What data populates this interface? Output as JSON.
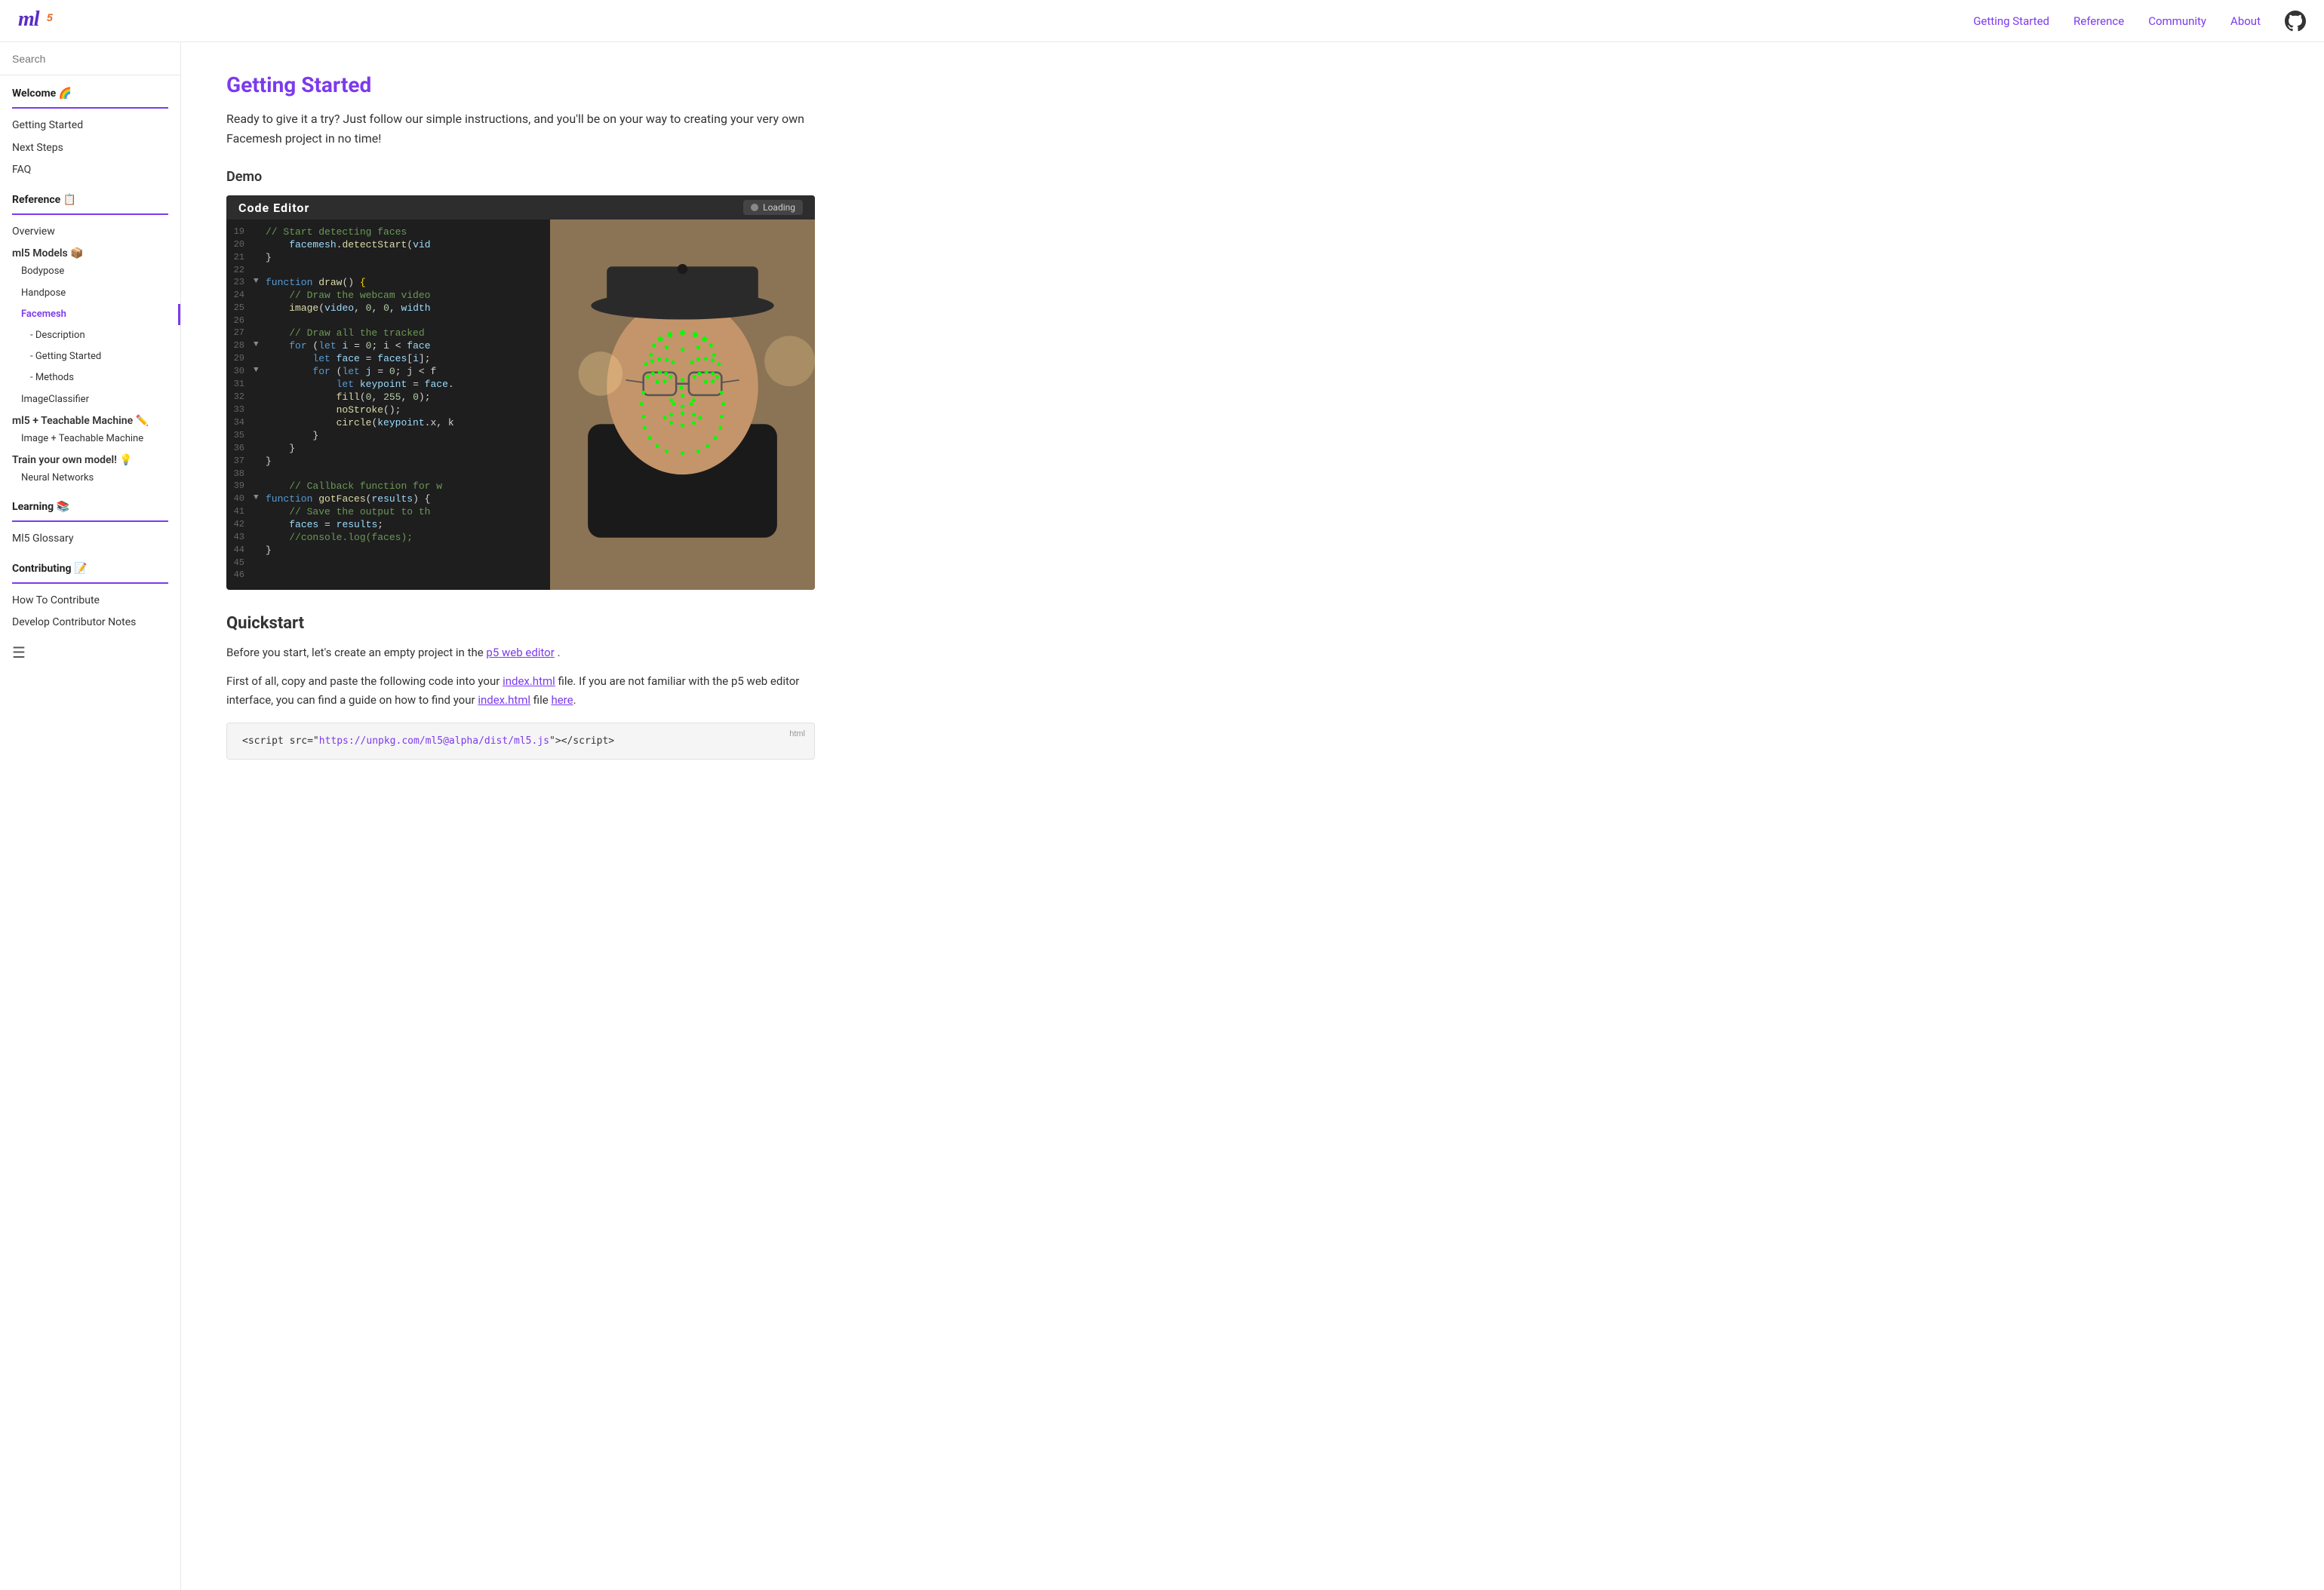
{
  "nav": {
    "logo_text": "ml",
    "logo_sub": "5",
    "links": [
      {
        "label": "Getting Started",
        "id": "getting-started"
      },
      {
        "label": "Reference",
        "id": "reference"
      },
      {
        "label": "Community",
        "id": "community"
      },
      {
        "label": "About",
        "id": "about"
      }
    ]
  },
  "sidebar": {
    "search_placeholder": "Search",
    "sections": [
      {
        "title": "Welcome 🌈",
        "items": [
          {
            "label": "Getting Started",
            "indent": 0,
            "active": false
          },
          {
            "label": "Next Steps",
            "indent": 0,
            "active": false
          },
          {
            "label": "FAQ",
            "indent": 0,
            "active": false
          }
        ]
      },
      {
        "title": "Reference 📋",
        "items": [
          {
            "label": "Overview",
            "indent": 0,
            "active": false
          },
          {
            "label": "ml5 Models 📦",
            "indent": 0,
            "group": true
          },
          {
            "label": "Bodypose",
            "indent": 1,
            "active": false
          },
          {
            "label": "Handpose",
            "indent": 1,
            "active": false
          },
          {
            "label": "Facemesh",
            "indent": 1,
            "active": true
          },
          {
            "label": "- Description",
            "indent": 2,
            "active": false
          },
          {
            "label": "- Getting Started",
            "indent": 2,
            "active": false
          },
          {
            "label": "- Methods",
            "indent": 2,
            "active": false
          },
          {
            "label": "ImageClassifier",
            "indent": 1,
            "active": false
          },
          {
            "label": "ml5 + Teachable Machine ✏️",
            "indent": 0,
            "group": true
          },
          {
            "label": "Image + Teachable Machine",
            "indent": 1,
            "active": false
          },
          {
            "label": "Train your own model! 💡",
            "indent": 0,
            "group": true
          },
          {
            "label": "Neural Networks",
            "indent": 1,
            "active": false
          }
        ]
      },
      {
        "title": "Learning 📚",
        "items": [
          {
            "label": "Ml5 Glossary",
            "indent": 0,
            "active": false
          }
        ]
      },
      {
        "title": "Contributing 📝",
        "items": [
          {
            "label": "How To Contribute",
            "indent": 0,
            "active": false
          },
          {
            "label": "Develop Contributor Notes",
            "indent": 0,
            "active": false
          }
        ]
      }
    ]
  },
  "main": {
    "page_title": "Getting Started",
    "intro": "Ready to give it a try? Just follow our simple instructions, and you'll be on your way to creating your very own Facemesh project in no time!",
    "demo_label": "Demo",
    "code_editor_title": "Code Editor",
    "loading_label": "Loading",
    "code_lines": [
      {
        "num": "19",
        "arrow": "",
        "text": "// Start detecting faces"
      },
      {
        "num": "20",
        "arrow": "",
        "text": "    facemesh.detectStart(vi"
      },
      {
        "num": "21",
        "arrow": "",
        "text": "}"
      },
      {
        "num": "22",
        "arrow": "",
        "text": ""
      },
      {
        "num": "23",
        "arrow": "▼",
        "text": "function draw() {"
      },
      {
        "num": "24",
        "arrow": "",
        "text": "    // Draw the webcam video"
      },
      {
        "num": "25",
        "arrow": "",
        "text": "    image(video, 0, 0, width"
      },
      {
        "num": "26",
        "arrow": "",
        "text": ""
      },
      {
        "num": "27",
        "arrow": "",
        "text": "    // Draw all the tracked"
      },
      {
        "num": "28",
        "arrow": "▼",
        "text": "    for (let i = 0; i < face"
      },
      {
        "num": "29",
        "arrow": "",
        "text": "        let face = faces[i];"
      },
      {
        "num": "30",
        "arrow": "▼",
        "text": "        for (let j = 0; j < f"
      },
      {
        "num": "31",
        "arrow": "",
        "text": "            let keypoint = face."
      },
      {
        "num": "32",
        "arrow": "",
        "text": "            fill(0, 255, 0);"
      },
      {
        "num": "33",
        "arrow": "",
        "text": "            noStroke();"
      },
      {
        "num": "34",
        "arrow": "",
        "text": "            circle(keypoint.x, k"
      },
      {
        "num": "35",
        "arrow": "",
        "text": "        }"
      },
      {
        "num": "36",
        "arrow": "",
        "text": "    }"
      },
      {
        "num": "37",
        "arrow": "",
        "text": "}"
      },
      {
        "num": "38",
        "arrow": "",
        "text": ""
      },
      {
        "num": "39",
        "arrow": "",
        "text": "    // Callback function for w"
      },
      {
        "num": "40",
        "arrow": "▼",
        "text": "function gotFaces(results) {"
      },
      {
        "num": "41",
        "arrow": "",
        "text": "    // Save the output to th"
      },
      {
        "num": "42",
        "arrow": "",
        "text": "    faces = results;"
      },
      {
        "num": "43",
        "arrow": "",
        "text": "    //console.log(faces);"
      },
      {
        "num": "44",
        "arrow": "",
        "text": "}"
      },
      {
        "num": "45",
        "arrow": "",
        "text": ""
      },
      {
        "num": "46",
        "arrow": "",
        "text": ""
      }
    ],
    "quickstart_title": "Quickstart",
    "quickstart_text1": "Before you start, let's create an empty project in the",
    "quickstart_link1": "p5 web editor",
    "quickstart_text1_end": ".",
    "quickstart_text2": "First of all, copy and paste the following code into your",
    "quickstart_link2": "index.html",
    "quickstart_text2_mid": "file. If you are not familiar with the p5 web editor interface, you can find a guide on how to find your",
    "quickstart_link3": "index.html",
    "quickstart_text2_end": "file",
    "quickstart_link4": "here",
    "code_block_label": "html",
    "code_block_text": "<script src=\"",
    "code_block_link": "https://unpkg.com/ml5@alpha/dist/ml5.js",
    "code_block_text2": "\"></",
    "code_block_text3": "script>"
  }
}
